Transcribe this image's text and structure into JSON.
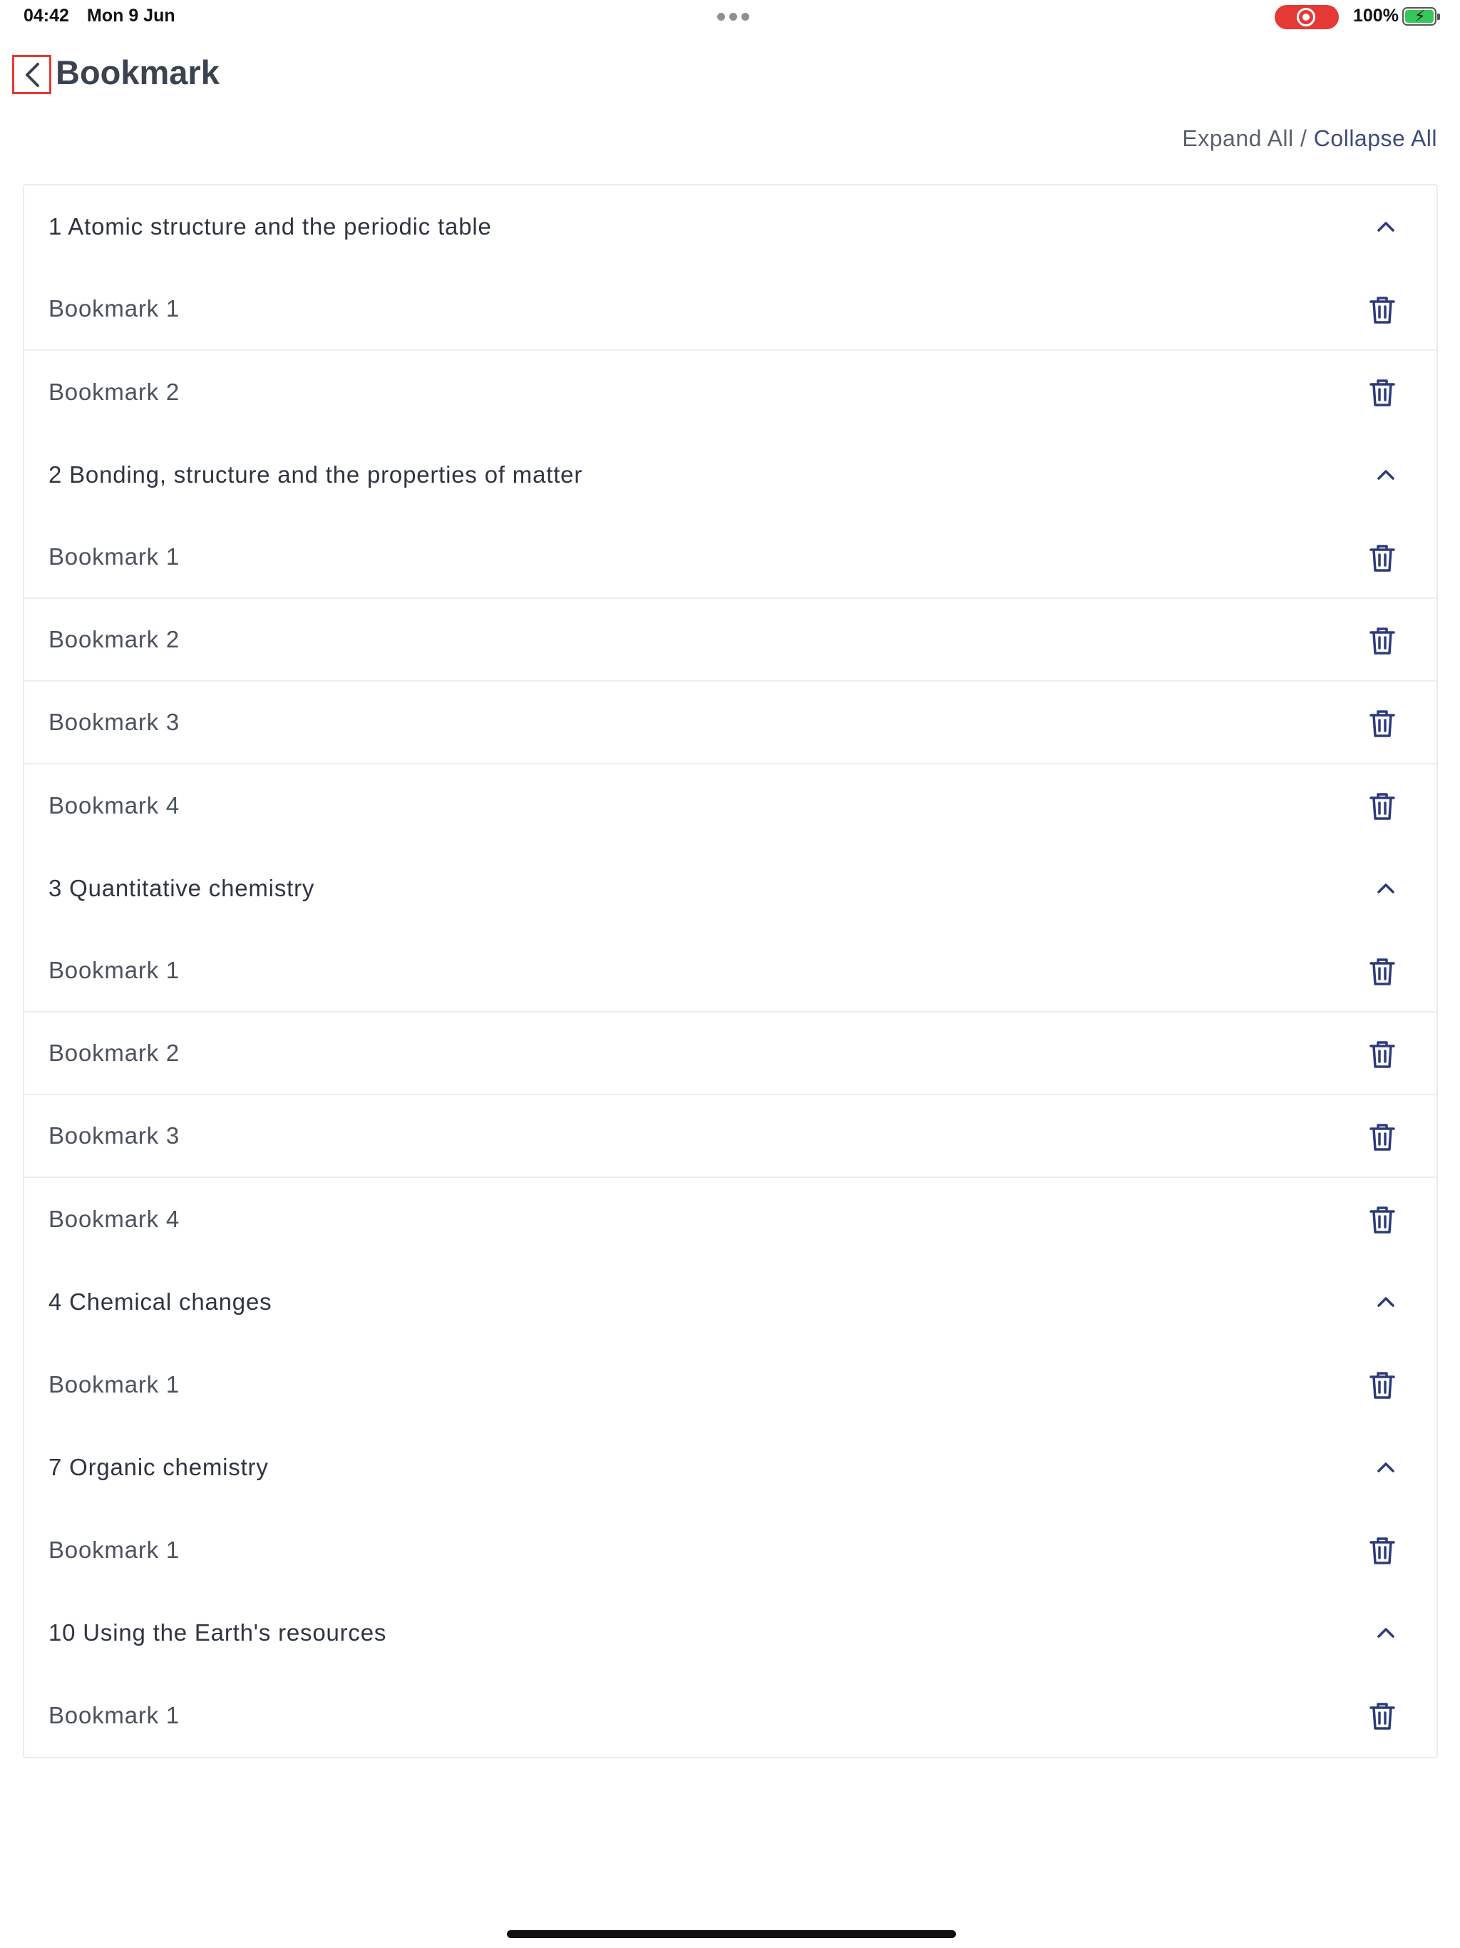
{
  "status_bar": {
    "time": "04:42",
    "date": "Mon 9 Jun",
    "battery_percent": "100%",
    "battery_level": 1.0,
    "recording_color": "#e53935"
  },
  "header": {
    "back_icon": "chevron-left-icon",
    "title": "Bookmark"
  },
  "controls": {
    "expand_all": "Expand All",
    "separator": " / ",
    "collapse_all": "Collapse All"
  },
  "colors": {
    "accent": "#3d4c7a",
    "icon": "#2d3b7a",
    "highlight_border": "#e53935"
  },
  "sections": [
    {
      "title": "1 Atomic structure and the periodic table",
      "expanded": true,
      "items": [
        "Bookmark 1",
        "Bookmark 2"
      ]
    },
    {
      "title": "2 Bonding, structure and the properties of matter",
      "expanded": true,
      "items": [
        "Bookmark 1",
        "Bookmark 2",
        "Bookmark 3",
        "Bookmark 4"
      ]
    },
    {
      "title": "3 Quantitative chemistry",
      "expanded": true,
      "items": [
        "Bookmark 1",
        "Bookmark 2",
        "Bookmark 3",
        "Bookmark 4"
      ]
    },
    {
      "title": "4 Chemical changes",
      "expanded": true,
      "items": [
        "Bookmark 1"
      ]
    },
    {
      "title": "7 Organic chemistry",
      "expanded": true,
      "items": [
        "Bookmark 1"
      ]
    },
    {
      "title": "10 Using the Earth's resources",
      "expanded": true,
      "items": [
        "Bookmark 1"
      ]
    }
  ]
}
